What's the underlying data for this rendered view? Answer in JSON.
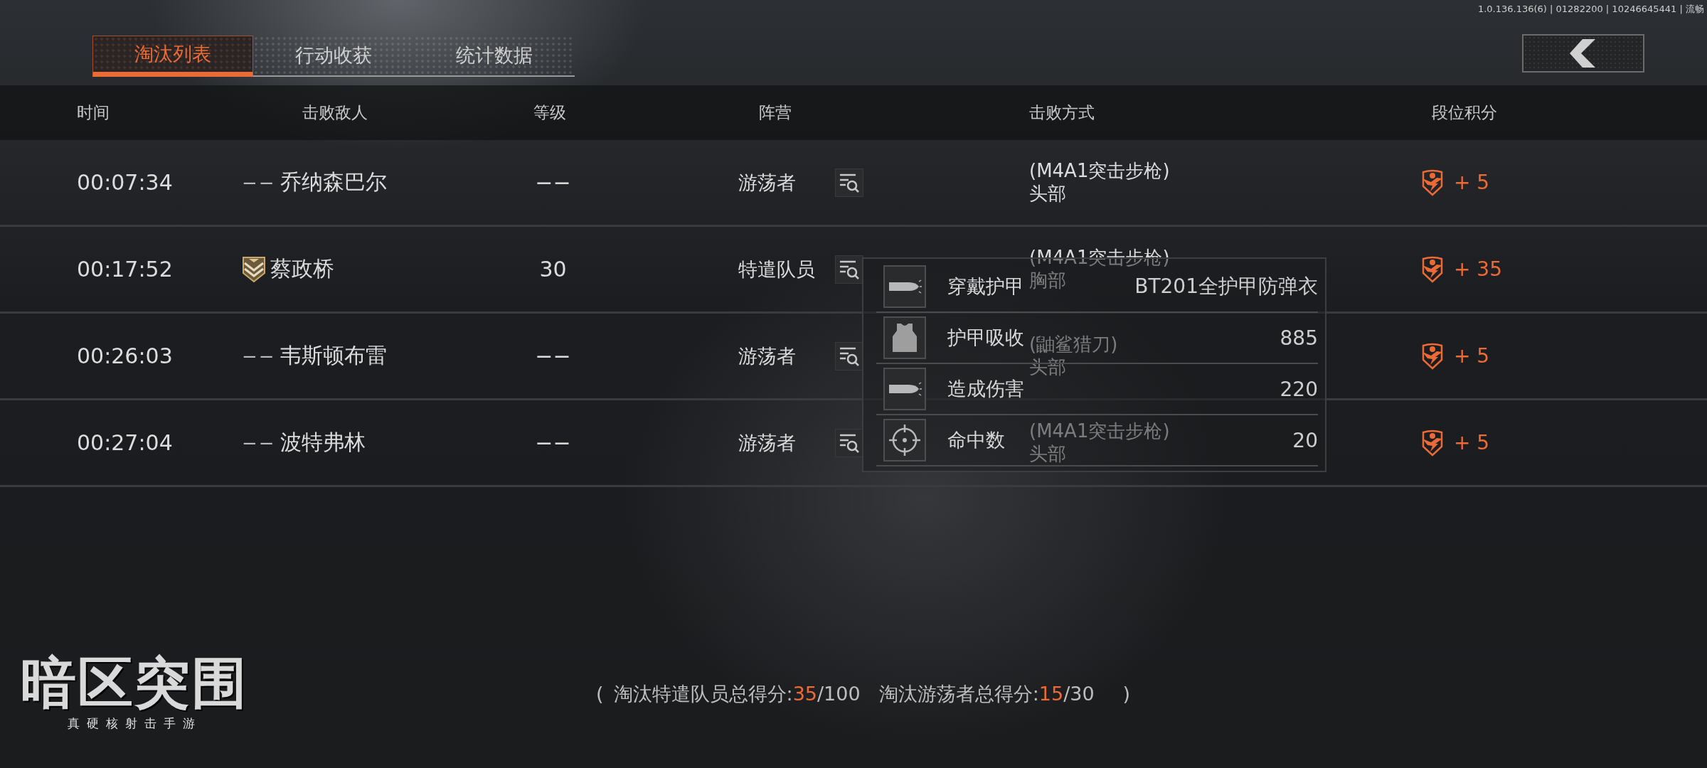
{
  "status_text": "1.0.136.136(6) | 01282200 | 10246645441 | 流畅",
  "tabs": [
    {
      "label": "淘汰列表",
      "selected": true
    },
    {
      "label": "行动收获",
      "selected": false
    },
    {
      "label": "统计数据",
      "selected": false
    }
  ],
  "table": {
    "columns": [
      "时间",
      "击败敌人",
      "等级",
      "阵营",
      "击败方式",
      "段位积分"
    ],
    "rows": [
      {
        "time": "00:07:34",
        "rank": {
          "kind": "text",
          "text": "−−"
        },
        "enemy": "乔纳森巴尔",
        "level": "−−",
        "faction": "游荡者",
        "weapon": "(M4A1突击步枪)",
        "hit": "头部",
        "score": "+ 5"
      },
      {
        "time": "00:17:52",
        "rank": {
          "kind": "badge"
        },
        "enemy": "蔡政桥",
        "level": "30",
        "faction": "特遣队员",
        "weapon": "(M4A1突击步枪)",
        "hit": "胸部",
        "score": "+ 35"
      },
      {
        "time": "00:26:03",
        "rank": {
          "kind": "text",
          "text": "−−"
        },
        "enemy": "韦斯顿布雷",
        "level": "−−",
        "faction": "游荡者",
        "weapon": "(鼬鲨猎刀)",
        "hit": "头部",
        "score": "+ 5"
      },
      {
        "time": "00:27:04",
        "rank": {
          "kind": "text",
          "text": "−−"
        },
        "enemy": "波特弗林",
        "level": "−−",
        "faction": "游荡者",
        "weapon": "(M4A1突击步枪)",
        "hit": "头部",
        "score": "+ 5"
      }
    ]
  },
  "details_popup": {
    "rows": [
      {
        "kind": "bullet",
        "label": "穿戴护甲",
        "value": "BT201全护甲防弹衣"
      },
      {
        "kind": "vest",
        "label": "护甲吸收",
        "value": "885"
      },
      {
        "kind": "bullet",
        "label": "造成伤害",
        "value": "220"
      },
      {
        "kind": "target",
        "label": "命中数",
        "value": "20"
      }
    ]
  },
  "summary": {
    "open": "(",
    "close": ")",
    "items": [
      {
        "label": "淘汰特遣队员总得分:",
        "score": "35",
        "max": "/100"
      },
      {
        "label": "淘汰游荡者总得分:",
        "score": "15",
        "max": "/30"
      }
    ]
  },
  "logo": {
    "title": "暗区突围",
    "tagline": "真硬核射击手游"
  }
}
